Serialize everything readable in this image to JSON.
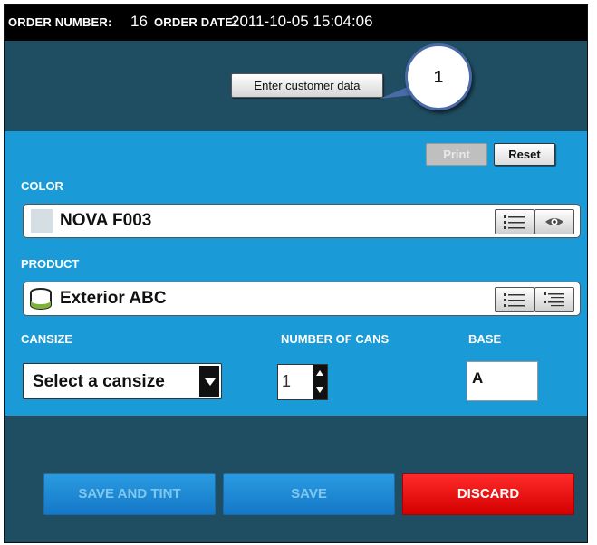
{
  "header": {
    "order_number_label": "ORDER NUMBER:",
    "order_number": "16",
    "order_date_label": "ORDER DATE:",
    "order_date": "2011-10-05 15:04:06"
  },
  "customer": {
    "enter_button": "Enter customer data"
  },
  "callout": {
    "number": "1"
  },
  "toolbar": {
    "print_label": "Print",
    "reset_label": "Reset"
  },
  "color": {
    "label": "COLOR",
    "value": "NOVA F003",
    "swatch": "#d5dee2"
  },
  "product": {
    "label": "PRODUCT",
    "value": "Exterior ABC"
  },
  "cansize": {
    "label": "CANSIZE",
    "selected": "Select a cansize"
  },
  "cans": {
    "label": "NUMBER OF CANS",
    "value": "1"
  },
  "base": {
    "label": "BASE",
    "value": "A"
  },
  "actions": {
    "save_and_tint": "SAVE AND TINT",
    "save": "SAVE",
    "discard": "DISCARD"
  },
  "colors": {
    "panel": "#1a9ad6",
    "background": "#1f4e63",
    "discard": "#e00000",
    "save": "#1a86d0"
  },
  "icons": [
    "list-icon",
    "eye-icon",
    "list-detail-icon",
    "paint-can-icon",
    "chevron-down-icon"
  ]
}
